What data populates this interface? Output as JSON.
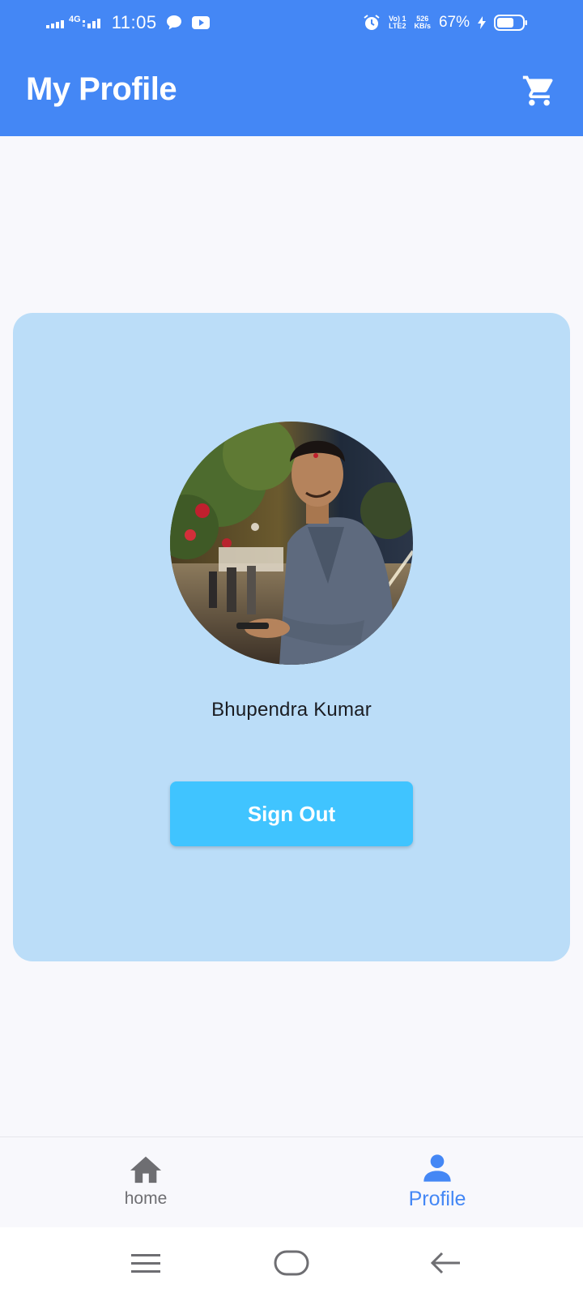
{
  "status_bar": {
    "time": "11:05",
    "network_label": "4G",
    "volte_line1": "Vo) 1",
    "volte_line2": "LTE2",
    "speed_value": "526",
    "speed_unit": "KB/s",
    "battery_percent": "67%",
    "battery_level": 0.67
  },
  "app_bar": {
    "title": "My Profile",
    "cart_icon": "cart-icon"
  },
  "profile": {
    "name": "Bhupendra Kumar",
    "sign_out_label": "Sign Out"
  },
  "bottom_nav": {
    "items": [
      {
        "label": "home",
        "icon": "home-icon",
        "active": false
      },
      {
        "label": "Profile",
        "icon": "person-icon",
        "active": true
      }
    ]
  },
  "colors": {
    "primary": "#4487f5",
    "card_background": "#bbddf8",
    "button": "#40c4ff",
    "inactive": "#6e6e72"
  }
}
